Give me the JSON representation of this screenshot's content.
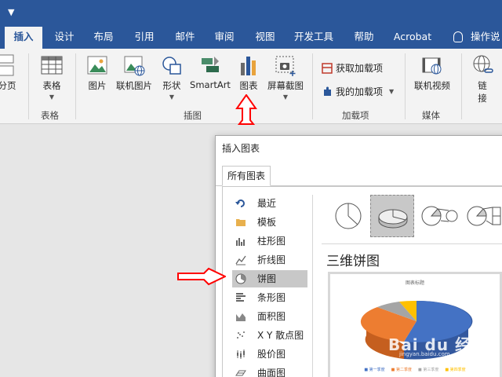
{
  "ribbon_tabs": [
    "插入",
    "设计",
    "布局",
    "引用",
    "邮件",
    "审阅",
    "视图",
    "开发工具",
    "帮助",
    "Acrobat",
    "操作说"
  ],
  "ribbon": {
    "page_label": "分页",
    "table_label": "表格",
    "picture_label": "图片",
    "online_picture_label": "联机图片",
    "shapes_label": "形状",
    "smartart_label": "SmartArt",
    "chart_label": "图表",
    "screenshot_label": "屏幕截图",
    "get_addins_label": "获取加载项",
    "my_addins_label": "我的加载项",
    "online_video_label": "联机视频",
    "link_label_1": "链",
    "link_label_2": "接",
    "groups": {
      "tables": "表格",
      "illustrations": "插图",
      "addins": "加载项",
      "media": "媒体"
    }
  },
  "dialog": {
    "title": "插入图表",
    "tab_all": "所有图表",
    "categories": [
      {
        "label": "最近",
        "icon": "recent-icon"
      },
      {
        "label": "模板",
        "icon": "folder-icon"
      },
      {
        "label": "柱形图",
        "icon": "column-chart-icon"
      },
      {
        "label": "折线图",
        "icon": "line-chart-icon"
      },
      {
        "label": "饼图",
        "icon": "pie-chart-icon"
      },
      {
        "label": "条形图",
        "icon": "bar-chart-icon"
      },
      {
        "label": "面积图",
        "icon": "area-chart-icon"
      },
      {
        "label": "X Y 散点图",
        "icon": "scatter-chart-icon"
      },
      {
        "label": "股价图",
        "icon": "stock-chart-icon"
      },
      {
        "label": "曲面图",
        "icon": "surface-chart-icon"
      }
    ],
    "selected_category": "饼图",
    "subtype_title": "三维饼图",
    "preview": {
      "chart_title": "图表标题",
      "legend": [
        "第一季度",
        "第二季度",
        "第三季度",
        "第四季度"
      ]
    }
  },
  "watermark": {
    "text": "Bai du 经验",
    "sub": "jingyan.baidu.com"
  },
  "colors": {
    "brand": "#2b579a",
    "slice_blue": "#4472c4",
    "slice_orange": "#ed7d31",
    "slice_gray": "#a5a5a5",
    "slice_yellow": "#ffc000",
    "annotation_red": "#ff0000"
  }
}
